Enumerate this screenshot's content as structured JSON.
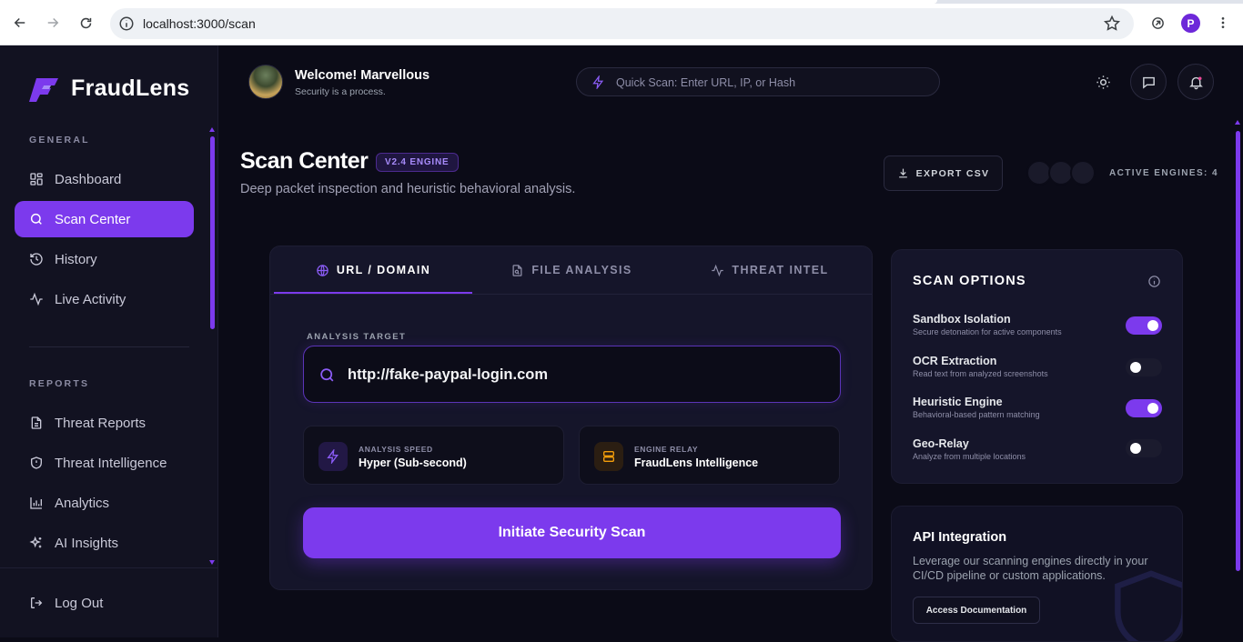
{
  "browser": {
    "url": "localhost:3000/scan",
    "profile_initial": "P"
  },
  "sidebar": {
    "brand": "FraudLens",
    "general_label": "GENERAL",
    "general_items": [
      {
        "label": "Dashboard",
        "icon": "grid-icon",
        "active": false
      },
      {
        "label": "Scan Center",
        "icon": "search-icon",
        "active": true
      },
      {
        "label": "History",
        "icon": "history-icon",
        "active": false
      },
      {
        "label": "Live Activity",
        "icon": "activity-icon",
        "active": false
      }
    ],
    "reports_label": "REPORTS",
    "reports_items": [
      {
        "label": "Threat Reports",
        "icon": "document-icon"
      },
      {
        "label": "Threat Intelligence",
        "icon": "shield-icon"
      },
      {
        "label": "Analytics",
        "icon": "bar-chart-icon"
      },
      {
        "label": "AI Insights",
        "icon": "sparkles-icon"
      }
    ],
    "logout_label": "Log Out"
  },
  "header": {
    "welcome": "Welcome! Marvellous",
    "subtitle": "Security is a process.",
    "quick_scan_placeholder": "Quick Scan: Enter URL, IP, or Hash"
  },
  "page": {
    "title": "Scan Center",
    "engine_badge": "V2.4 ENGINE",
    "subtitle": "Deep packet inspection and heuristic behavioral analysis.",
    "export_label": "EXPORT CSV",
    "active_engines": "ACTIVE ENGINES: 4"
  },
  "scan": {
    "tabs": [
      {
        "label": "URL / DOMAIN",
        "icon": "globe-icon",
        "active": true
      },
      {
        "label": "FILE ANALYSIS",
        "icon": "file-search-icon",
        "active": false
      },
      {
        "label": "THREAT INTEL",
        "icon": "pulse-icon",
        "active": false
      }
    ],
    "target_label": "ANALYSIS TARGET",
    "target_value": "http://fake-paypal-login.com",
    "speed_label": "ANALYSIS SPEED",
    "speed_value": "Hyper (Sub-second)",
    "relay_label": "ENGINE RELAY",
    "relay_value": "FraudLens Intelligence",
    "button_label": "Initiate Security Scan"
  },
  "options": {
    "title": "SCAN OPTIONS",
    "items": [
      {
        "name": "Sandbox Isolation",
        "desc": "Secure detonation for active components",
        "enabled": true
      },
      {
        "name": "OCR Extraction",
        "desc": "Read text from analyzed screenshots",
        "enabled": false
      },
      {
        "name": "Heuristic Engine",
        "desc": "Behavioral-based pattern matching",
        "enabled": true
      },
      {
        "name": "Geo-Relay",
        "desc": "Analyze from multiple locations",
        "enabled": false
      }
    ]
  },
  "api": {
    "title": "API Integration",
    "description": "Leverage our scanning engines directly in your CI/CD pipeline or custom applications.",
    "button_label": "Access Documentation"
  },
  "colors": {
    "accent": "#7c3aed",
    "background": "#0b0b17",
    "sidebar": "#121221",
    "card": "#15152a",
    "relay_icon": "#f59e0b"
  }
}
